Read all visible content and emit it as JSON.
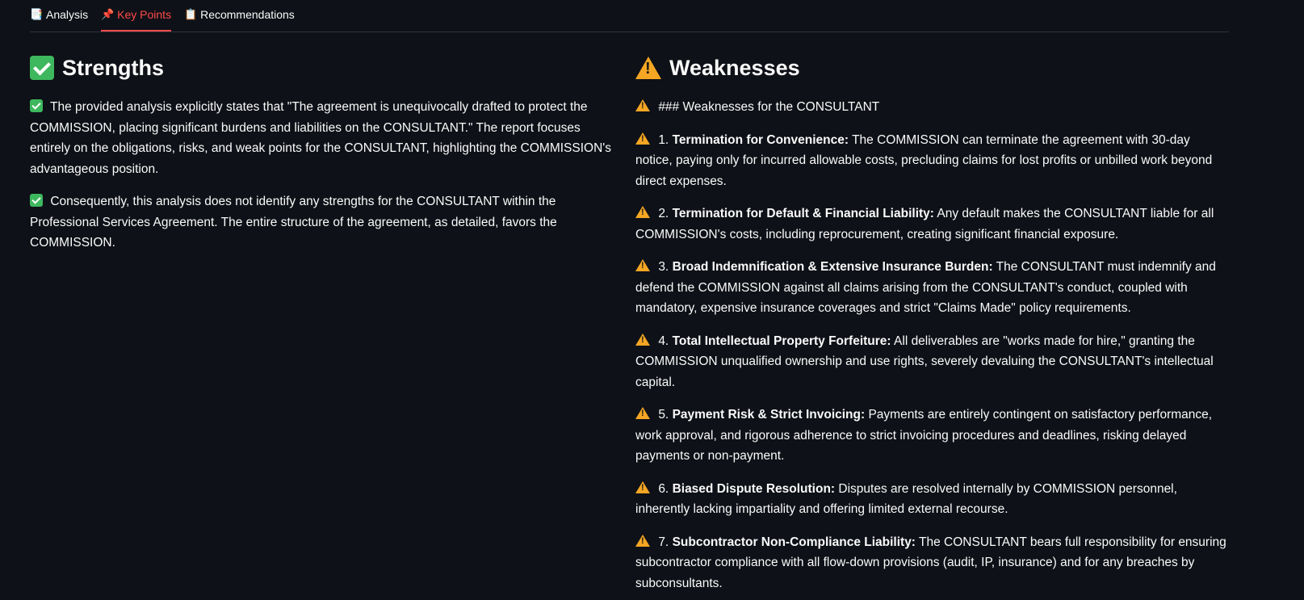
{
  "tabs": [
    {
      "icon": "document-icon",
      "glyph": "📑",
      "label": "Analysis",
      "active": false
    },
    {
      "icon": "pushpin-icon",
      "glyph": "📌",
      "label": "Key Points",
      "active": true
    },
    {
      "icon": "clipboard-icon",
      "glyph": "📋",
      "label": "Recommendations",
      "active": false
    }
  ],
  "colors": {
    "background": "#0e1117",
    "accent": "#ff4b4b",
    "check": "#3eb85e",
    "warning": "#f5a623"
  },
  "strengths": {
    "title": "Strengths",
    "icon": "check-mark-icon",
    "items": [
      "The provided analysis explicitly states that \"The agreement is unequivocally drafted to protect the COMMISSION, placing significant burdens and liabilities on the CONSULTANT.\" The report focuses entirely on the obligations, risks, and weak points for the CONSULTANT, highlighting the COMMISSION's advantageous position.",
      "Consequently, this analysis does not identify any strengths for the CONSULTANT within the Professional Services Agreement. The entire structure of the agreement, as detailed, favors the COMMISSION."
    ]
  },
  "weaknesses": {
    "title": "Weaknesses",
    "icon": "warning-icon",
    "intro": "### Weaknesses for the CONSULTANT",
    "items": [
      {
        "num": "1.",
        "bold": "Termination for Convenience:",
        "text": "The COMMISSION can terminate the agreement with 30-day notice, paying only for incurred allowable costs, precluding claims for lost profits or unbilled work beyond direct expenses."
      },
      {
        "num": "2.",
        "bold": "Termination for Default & Financial Liability:",
        "text": "Any default makes the CONSULTANT liable for all COMMISSION's costs, including reprocurement, creating significant financial exposure."
      },
      {
        "num": "3.",
        "bold": "Broad Indemnification & Extensive Insurance Burden:",
        "text": "The CONSULTANT must indemnify and defend the COMMISSION against all claims arising from the CONSULTANT's conduct, coupled with mandatory, expensive insurance coverages and strict \"Claims Made\" policy requirements."
      },
      {
        "num": "4.",
        "bold": "Total Intellectual Property Forfeiture:",
        "text": "All deliverables are \"works made for hire,\" granting the COMMISSION unqualified ownership and use rights, severely devaluing the CONSULTANT's intellectual capital."
      },
      {
        "num": "5.",
        "bold": "Payment Risk & Strict Invoicing:",
        "text": "Payments are entirely contingent on satisfactory performance, work approval, and rigorous adherence to strict invoicing procedures and deadlines, risking delayed payments or non-payment."
      },
      {
        "num": "6.",
        "bold": "Biased Dispute Resolution:",
        "text": "Disputes are resolved internally by COMMISSION personnel, inherently lacking impartiality and offering limited external recourse."
      },
      {
        "num": "7.",
        "bold": "Subcontractor Non-Compliance Liability:",
        "text": "The CONSULTANT bears full responsibility for ensuring subcontractor compliance with all flow-down provisions (audit, IP, insurance) and for any breaches by subconsultants."
      }
    ]
  }
}
